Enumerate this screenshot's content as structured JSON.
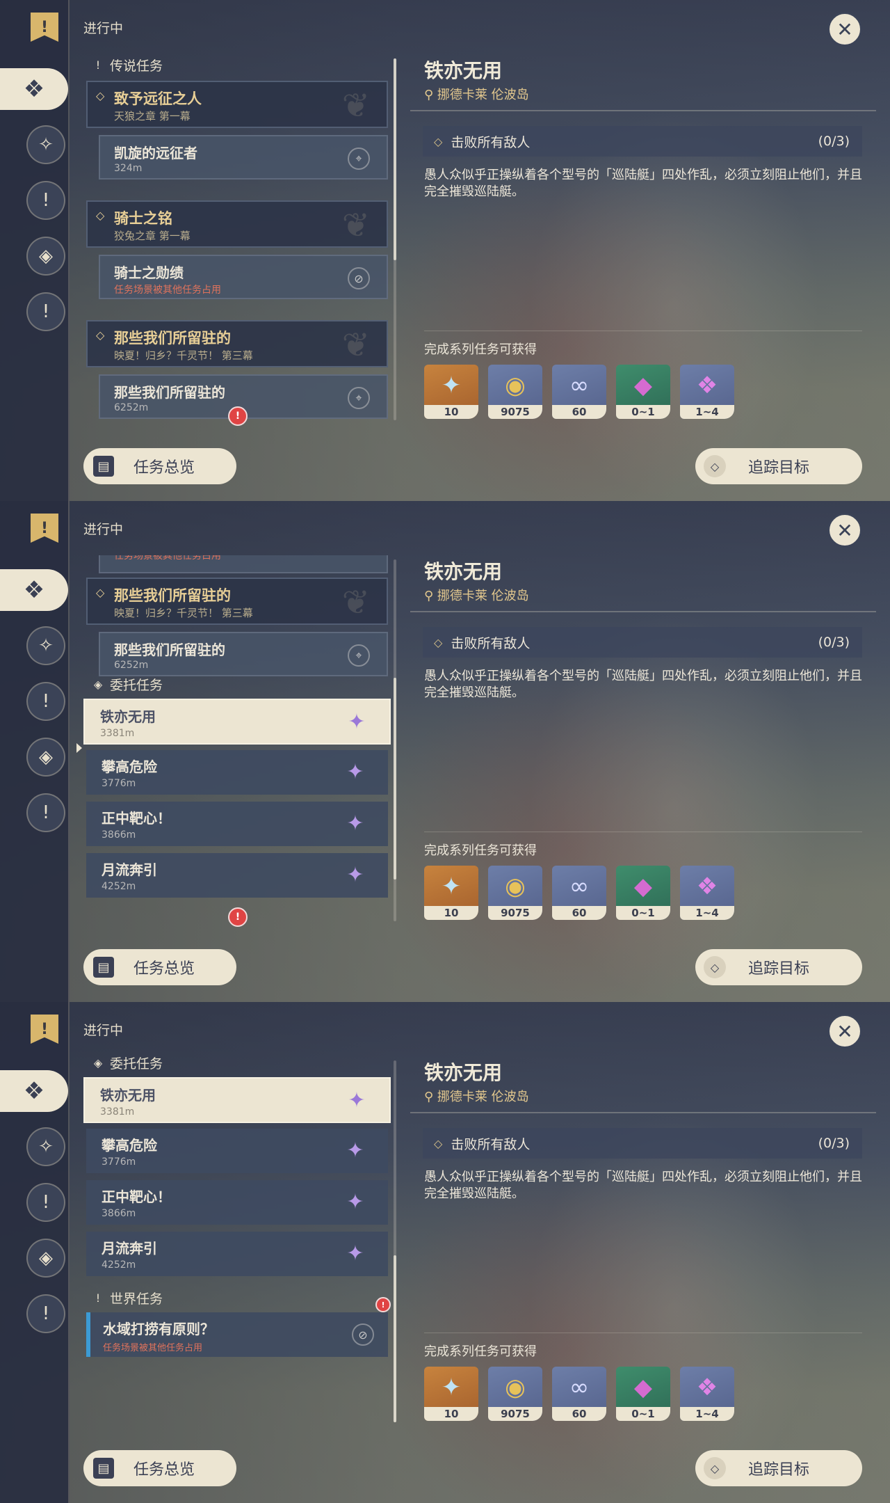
{
  "header": {
    "status_label": "进行中"
  },
  "sections": {
    "legend": "传说任务",
    "commission": "委托任务",
    "world": "世界任务"
  },
  "legend_quests": [
    {
      "title": "致予远征之人",
      "subtitle": "天狼之章 第一幕",
      "quest": "凯旋的远征者",
      "detail": "324m",
      "detail_red": false,
      "icon": "map-pin-icon"
    },
    {
      "title": "骑士之铭",
      "subtitle": "狡兔之章 第一幕",
      "quest": "骑士之勋绩",
      "detail": "任务场景被其他任务占用",
      "detail_red": true,
      "icon": "blocked-icon"
    },
    {
      "title": "那些我们所留驻的",
      "subtitle": "映夏！归乡？千灵节！ 第三幕",
      "quest": "那些我们所留驻的",
      "detail": "6252m",
      "detail_red": false,
      "icon": "map-pin-icon"
    }
  ],
  "commissions": [
    {
      "title": "铁亦无用",
      "distance": "3381m",
      "selected": true
    },
    {
      "title": "攀高危险",
      "distance": "3776m",
      "selected": false
    },
    {
      "title": "正中靶心！",
      "distance": "3866m",
      "selected": false
    },
    {
      "title": "月流奔引",
      "distance": "4252m",
      "selected": false
    }
  ],
  "world_quest": {
    "title": "水域打捞有原则？",
    "detail": "任务场景被其他任务占用"
  },
  "detail": {
    "title": "铁亦无用",
    "location": "挪德卡莱 伦波岛",
    "objective": "击败所有敌人",
    "objective_count": "(0/3)",
    "description": "愚人众似乎正操纵着各个型号的「巡陆艇」四处作乱，必须立刻阻止他们，并且完全摧毁巡陆艇。",
    "rewards_label": "完成系列任务可获得",
    "rewards": [
      {
        "icon": "primogem-icon",
        "qty": "10",
        "style": "orange",
        "glyph": "✦",
        "color": "#bfe3f5"
      },
      {
        "icon": "mora-icon",
        "qty": "9075",
        "style": "blue",
        "glyph": "◉",
        "color": "#e7c25a"
      },
      {
        "icon": "adventure-exp-icon",
        "qty": "60",
        "style": "blue",
        "glyph": "∞",
        "color": "#d8dcff"
      },
      {
        "icon": "crystal-chunk-icon",
        "qty": "0~1",
        "style": "teal",
        "glyph": "◆",
        "color": "#d56bd0"
      },
      {
        "icon": "crystal-cluster-icon",
        "qty": "1~4",
        "style": "blue",
        "glyph": "❖",
        "color": "#e084e6"
      }
    ]
  },
  "buttons": {
    "overview": "任务总览",
    "track": "追踪目标"
  }
}
